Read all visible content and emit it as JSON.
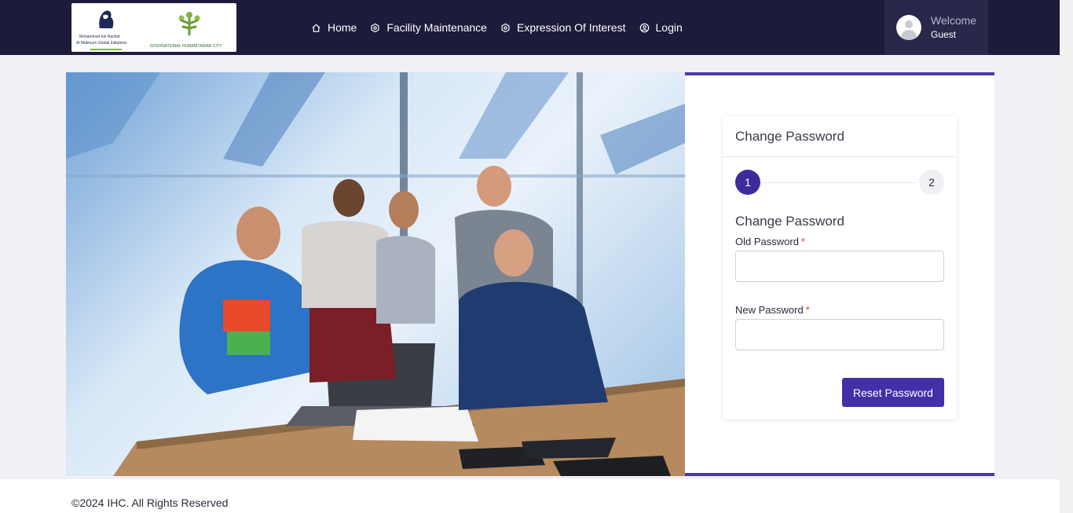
{
  "header": {
    "logo_left_lines": [
      "Mohammed bin Rashid",
      "Al Maktoum Global Initiatives"
    ],
    "logo_right_line": "INTERNATIONAL HUMANITARIAN CITY",
    "nav": [
      {
        "label": "Home",
        "icon": "home-icon"
      },
      {
        "label": "Facility Maintenance",
        "icon": "gear-icon"
      },
      {
        "label": "Expression Of Interest",
        "icon": "gear-icon"
      },
      {
        "label": "Login",
        "icon": "user-circle-icon"
      }
    ],
    "welcome_title": "Welcome",
    "welcome_name": "Guest"
  },
  "card": {
    "title": "Change Password",
    "steps": [
      "1",
      "2"
    ],
    "active_step": 1,
    "section_title": "Change Password",
    "old_password_label": "Old Password",
    "new_password_label": "New Password",
    "required_mark": "*",
    "old_password_value": "",
    "new_password_value": "",
    "submit_label": "Reset Password"
  },
  "footer": {
    "copyright": "©2024 IHC. All Rights Reserved"
  },
  "colors": {
    "header_bg": "#1d1b3a",
    "accent": "#4330a8",
    "required": "#e53935"
  }
}
